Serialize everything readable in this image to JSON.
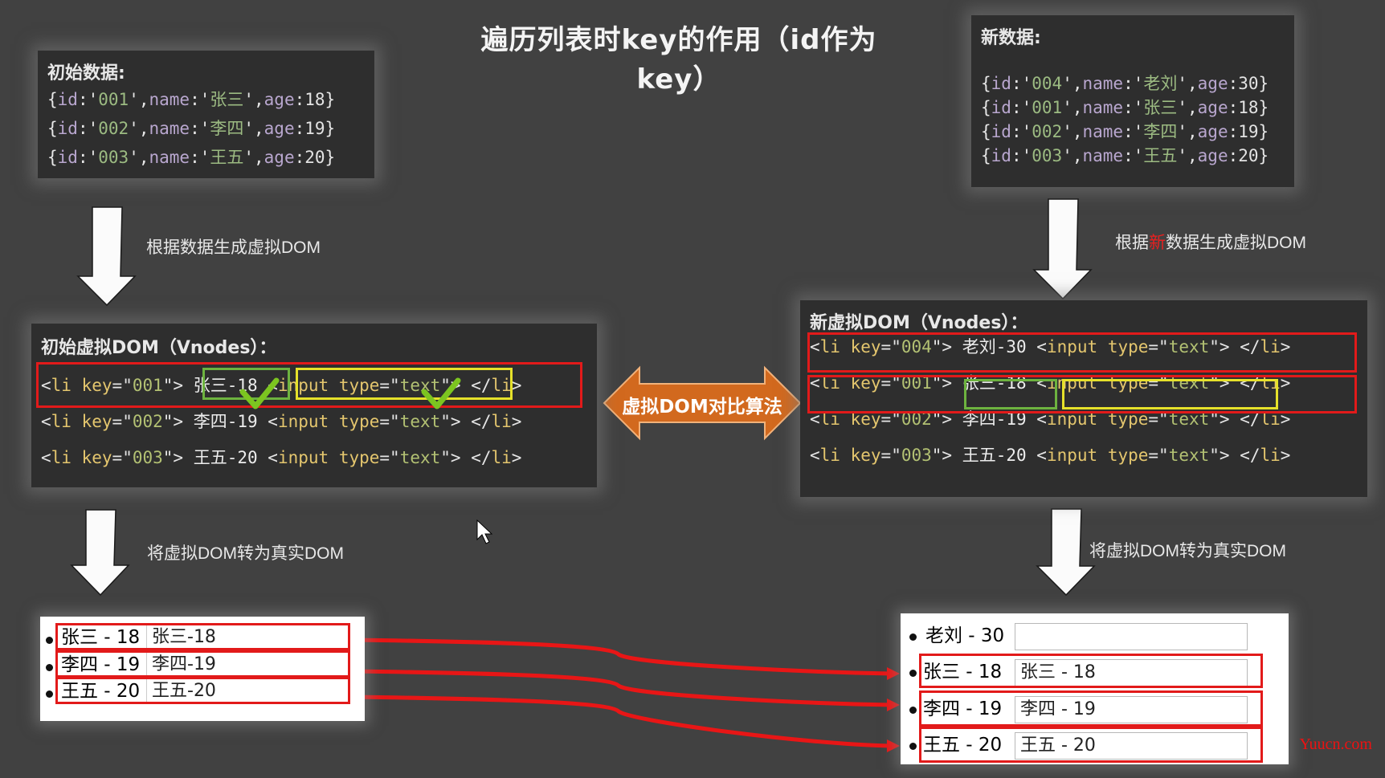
{
  "title": "遍历列表时key的作用（id作为key）",
  "initial_data": {
    "heading": "初始数据:",
    "rows": [
      {
        "id": "001",
        "name": "张三",
        "age": "18"
      },
      {
        "id": "002",
        "name": "李四",
        "age": "19"
      },
      {
        "id": "003",
        "name": "王五",
        "age": "20"
      }
    ]
  },
  "new_data": {
    "heading": "新数据:",
    "rows": [
      {
        "id": "004",
        "name": "老刘",
        "age": "30"
      },
      {
        "id": "001",
        "name": "张三",
        "age": "18"
      },
      {
        "id": "002",
        "name": "李四",
        "age": "19"
      },
      {
        "id": "003",
        "name": "王五",
        "age": "20"
      }
    ]
  },
  "labels": {
    "gen_initial": "根据数据生成虚拟DOM",
    "gen_new_prefix": "根据",
    "gen_new_highlight": "新",
    "gen_new_suffix": "数据生成虚拟DOM",
    "to_real_left": "将虚拟DOM转为真实DOM",
    "to_real_right": "将虚拟DOM转为真实DOM",
    "diff": "虚拟DOM对比算法"
  },
  "initial_vdom": {
    "heading": "初始虚拟DOM（Vnodes）：",
    "items": [
      {
        "key": "001",
        "text": "张三-18"
      },
      {
        "key": "002",
        "text": "李四-19"
      },
      {
        "key": "003",
        "text": "王五-20"
      }
    ]
  },
  "new_vdom": {
    "heading": "新虚拟DOM（Vnodes）：",
    "items": [
      {
        "key": "004",
        "text": "老刘-30"
      },
      {
        "key": "001",
        "text": "张三-18"
      },
      {
        "key": "002",
        "text": "李四-19"
      },
      {
        "key": "003",
        "text": "王五-20"
      }
    ]
  },
  "code_tokens": {
    "id_prop": "id",
    "name_prop": "name",
    "age_prop": "age",
    "li_open": "li",
    "key_attr": "key",
    "input_tag": "input",
    "type_attr": "type",
    "type_val": "text",
    "li_close": "li"
  },
  "real_dom_left": {
    "items": [
      {
        "label": "张三 - 18",
        "input_value": "张三-18"
      },
      {
        "label": "李四 - 19",
        "input_value": "李四-19"
      },
      {
        "label": "王五 - 20",
        "input_value": "王五-20"
      }
    ]
  },
  "real_dom_right": {
    "items": [
      {
        "label": "老刘 - 30",
        "input_value": ""
      },
      {
        "label": "张三 - 18",
        "input_value": "张三 - 18"
      },
      {
        "label": "李四 - 19",
        "input_value": "李四 - 19"
      },
      {
        "label": "王五 - 20",
        "input_value": "王五 - 20"
      }
    ]
  },
  "colors": {
    "background": "#414141",
    "panel": "#2e2e2e",
    "highlight_red": "#e21a1a",
    "match_green": "#6db33f",
    "match_yellow": "#e6e12a",
    "diff_arrow": "#d2691e",
    "check_green": "#7cc520"
  },
  "watermark": "Yuucn.com"
}
